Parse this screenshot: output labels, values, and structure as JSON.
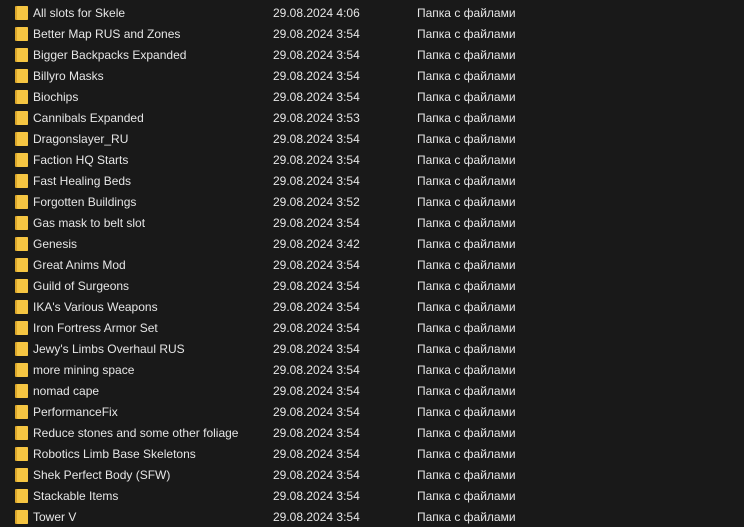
{
  "folder_icon": "folder-icon",
  "colors": {
    "background": "#191919",
    "text": "#e6e6e6",
    "folder_front": "#f5c542",
    "folder_back": "#dca82d"
  },
  "files": [
    {
      "name": "All slots for Skele",
      "date": "29.08.2024 4:06",
      "type": "Папка с файлами"
    },
    {
      "name": "Better Map RUS and Zones",
      "date": "29.08.2024 3:54",
      "type": "Папка с файлами"
    },
    {
      "name": "Bigger Backpacks Expanded",
      "date": "29.08.2024 3:54",
      "type": "Папка с файлами"
    },
    {
      "name": "Billyro Masks",
      "date": "29.08.2024 3:54",
      "type": "Папка с файлами"
    },
    {
      "name": "Biochips",
      "date": "29.08.2024 3:54",
      "type": "Папка с файлами"
    },
    {
      "name": "Cannibals Expanded",
      "date": "29.08.2024 3:53",
      "type": "Папка с файлами"
    },
    {
      "name": "Dragonslayer_RU",
      "date": "29.08.2024 3:54",
      "type": "Папка с файлами"
    },
    {
      "name": "Faction HQ Starts",
      "date": "29.08.2024 3:54",
      "type": "Папка с файлами"
    },
    {
      "name": "Fast Healing Beds",
      "date": "29.08.2024 3:54",
      "type": "Папка с файлами"
    },
    {
      "name": "Forgotten Buildings",
      "date": "29.08.2024 3:52",
      "type": "Папка с файлами"
    },
    {
      "name": "Gas mask to belt slot",
      "date": "29.08.2024 3:54",
      "type": "Папка с файлами"
    },
    {
      "name": "Genesis",
      "date": "29.08.2024 3:42",
      "type": "Папка с файлами"
    },
    {
      "name": "Great Anims Mod",
      "date": "29.08.2024 3:54",
      "type": "Папка с файлами"
    },
    {
      "name": "Guild of Surgeons",
      "date": "29.08.2024 3:54",
      "type": "Папка с файлами"
    },
    {
      "name": "IKA's Various Weapons",
      "date": "29.08.2024 3:54",
      "type": "Папка с файлами"
    },
    {
      "name": "Iron Fortress Armor Set",
      "date": "29.08.2024 3:54",
      "type": "Папка с файлами"
    },
    {
      "name": "Jewy's Limbs Overhaul RUS",
      "date": "29.08.2024 3:54",
      "type": "Папка с файлами"
    },
    {
      "name": "more mining space",
      "date": "29.08.2024 3:54",
      "type": "Папка с файлами"
    },
    {
      "name": "nomad cape",
      "date": "29.08.2024 3:54",
      "type": "Папка с файлами"
    },
    {
      "name": "PerformanceFix",
      "date": "29.08.2024 3:54",
      "type": "Папка с файлами"
    },
    {
      "name": "Reduce stones and some other foliage",
      "date": "29.08.2024 3:54",
      "type": "Папка с файлами"
    },
    {
      "name": "Robotics Limb Base Skeletons",
      "date": "29.08.2024 3:54",
      "type": "Папка с файлами"
    },
    {
      "name": "Shek Perfect Body (SFW)",
      "date": "29.08.2024 3:54",
      "type": "Папка с файлами"
    },
    {
      "name": "Stackable Items",
      "date": "29.08.2024 3:54",
      "type": "Папка с файлами"
    },
    {
      "name": "Tower V",
      "date": "29.08.2024 3:54",
      "type": "Папка с файлами"
    }
  ]
}
